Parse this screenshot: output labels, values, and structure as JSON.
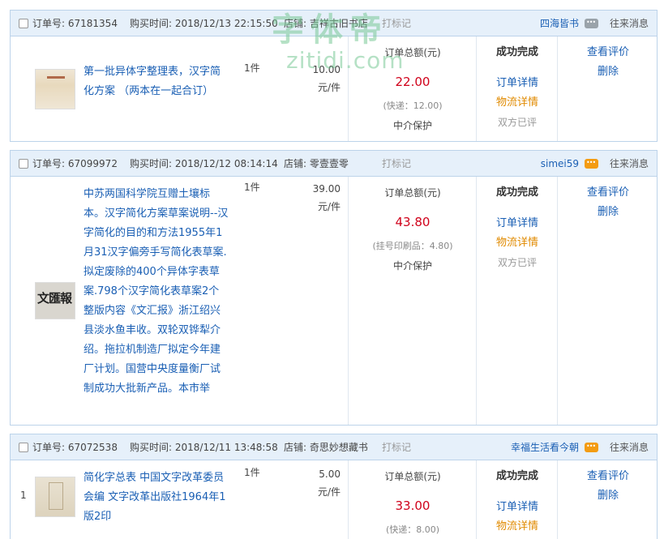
{
  "labels": {
    "order_no": "订单号:",
    "buy_time": "购买时间:",
    "shop": "店铺:",
    "mark": "打标记",
    "messages": "往来消息",
    "total": "订单总额(元)",
    "protect": "中介保护",
    "status": "成功完成",
    "order_detail": "订单详情",
    "logistics": "物流详情",
    "rated": "双方已评",
    "view_review": "查看评价",
    "delete": "删除",
    "per_unit": "元/件"
  },
  "watermark": {
    "cn": "字体帝",
    "en": "zitidi.com"
  },
  "orders": [
    {
      "order_no": "67181354",
      "time": "2018/12/13 22:15:50",
      "shop": "吉祥古旧书店",
      "seller": "四海皆书",
      "title": "第一批异体字整理表，汉字简化方案 （两本在一起合订）",
      "qty": "1件",
      "price": "10.00",
      "total": "22.00",
      "shipping": "(快递：12.00)"
    },
    {
      "order_no": "67099972",
      "time": "2018/12/12 08:14:14",
      "shop": "零壹壹零",
      "seller": "simei59",
      "title": "中苏两国科学院互赠土壤标本。汉字简化方案草案说明--汉字简化的目的和方法1955年1月31汉字偏旁手写简化表草案.拟定废除的400个异体字表草案.798个汉字简化表草案2个整版内容《文汇报》浙江绍兴县淡水鱼丰收。双轮双铧犁介绍。拖拉机制造厂拟定今年建厂计划。国营中央度量衡厂试制成功大批新产品。本市举",
      "qty": "1件",
      "price": "39.00",
      "total": "43.80",
      "shipping": "(挂号印刷品：4.80)"
    },
    {
      "row": "1",
      "order_no": "67072538",
      "time": "2018/12/11 13:48:58",
      "shop": "奇思妙想藏书",
      "seller": "幸福生活看今朝",
      "title": "简化字总表 中国文字改革委员会编 文字改革出版社1964年1版2印",
      "qty": "1件",
      "price": "5.00",
      "total": "33.00",
      "shipping": "(快递：8.00)"
    }
  ],
  "colors": {
    "header_bg": "#e6f0fa",
    "border": "#bcd3ea",
    "link": "#1a5fb4",
    "price": "#d0021b",
    "logistics": "#e08a00"
  }
}
